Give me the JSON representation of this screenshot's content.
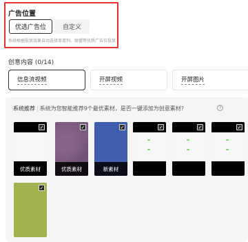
{
  "ad_position": {
    "title": "广告位置",
    "options": [
      "优选广告位",
      "自定义"
    ],
    "selected": "优选广告位",
    "hint": "系统根据投放效果自动选择单双列、联盟等优质广告位投放"
  },
  "creative": {
    "title": "创意内容 (0/14)",
    "tabs": [
      {
        "label": "信息流视频",
        "active": true
      },
      {
        "label": "开屏视频",
        "active": false
      },
      {
        "label": "开屏图片",
        "active": false
      }
    ]
  },
  "recommend": {
    "label": "系统推荐",
    "separator": "|",
    "description": "系统为您智能推荐9个最优素材，是否一键添加为创意素材?",
    "help_icon": "?",
    "items": [
      {
        "tag": "优质素材",
        "checked": true,
        "color": "#000000"
      },
      {
        "tag": "优质素材",
        "checked": true,
        "color": "#7a5a7e"
      },
      {
        "tag": "新素材",
        "checked": true,
        "color": "#3f5fae"
      },
      {
        "tag": "",
        "checked": true,
        "color": "#000000"
      },
      {
        "tag": "",
        "checked": true,
        "color": "#000000"
      },
      {
        "tag": "",
        "checked": true,
        "color": "#000000"
      },
      {
        "tag": "",
        "checked": true,
        "color": "#a3b14f"
      }
    ]
  },
  "colors": {
    "highlight_border": "#e5312b",
    "panel_bg": "#f5f5f5"
  }
}
